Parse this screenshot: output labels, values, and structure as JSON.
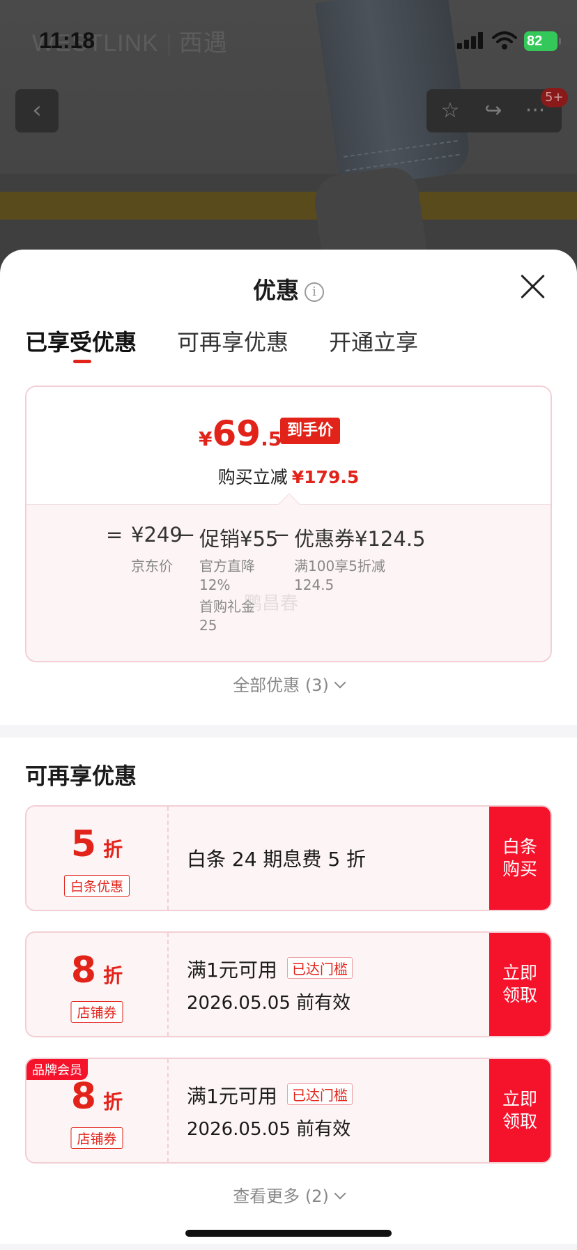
{
  "status_bar": {
    "time": "11:18",
    "battery": "82"
  },
  "background": {
    "logo_en": "WESTLINK",
    "logo_cn": "西遇"
  },
  "nav": {
    "back_icon": "‹",
    "star_icon": "☆",
    "share_icon": "↪",
    "more_icon": "···",
    "badge": "5+"
  },
  "sheet": {
    "title": "优惠",
    "info_icon": "i",
    "tabs": [
      {
        "label": "已享受优惠"
      },
      {
        "label": "可再享优惠"
      },
      {
        "label": "开通立享"
      }
    ],
    "final": {
      "currency": "¥",
      "price_int": "69",
      "price_dec": ".5",
      "tag": "到手价",
      "save_label": "购买立减",
      "save_amount": "¥179.5"
    },
    "formula": {
      "equals": "=",
      "base": "¥249",
      "minus1": "−",
      "promo": "促销¥55",
      "minus2": "−",
      "coupon": "优惠券¥124.5",
      "base_sub": "京东价",
      "promo_sub1_a": "官方直降",
      "promo_sub1_b": "12%",
      "promo_sub2_a": "首购礼金",
      "promo_sub2_b": "25",
      "coupon_sub_a": "满100享5折减",
      "coupon_sub_b": "124.5",
      "watermark": "鹏昌春"
    },
    "all_offers": "全部优惠 (3)",
    "section_title": "可再享优惠",
    "coupons": [
      {
        "value": "5",
        "unit": "折",
        "kind": "白条优惠",
        "desc": "白条 24 期息费 5 折",
        "btn1": "白条",
        "btn2": "购买"
      },
      {
        "value": "8",
        "unit": "折",
        "kind": "店铺券",
        "desc": "满1元可用",
        "threshold": "已达门槛",
        "expire": "2026.05.05 前有效",
        "btn1": "立即",
        "btn2": "领取"
      },
      {
        "value": "8",
        "unit": "折",
        "kind": "店铺券",
        "desc": "满1元可用",
        "threshold": "已达门槛",
        "expire": "2026.05.05 前有效",
        "btn1": "立即",
        "btn2": "领取",
        "corner": "品牌会员"
      }
    ],
    "more": "查看更多 (2)"
  },
  "colors": {
    "accent": "#e2231a",
    "button_red": "#f5132c",
    "coupon_bg": "#fdf4f5",
    "coupon_border": "#f3cfd4"
  }
}
